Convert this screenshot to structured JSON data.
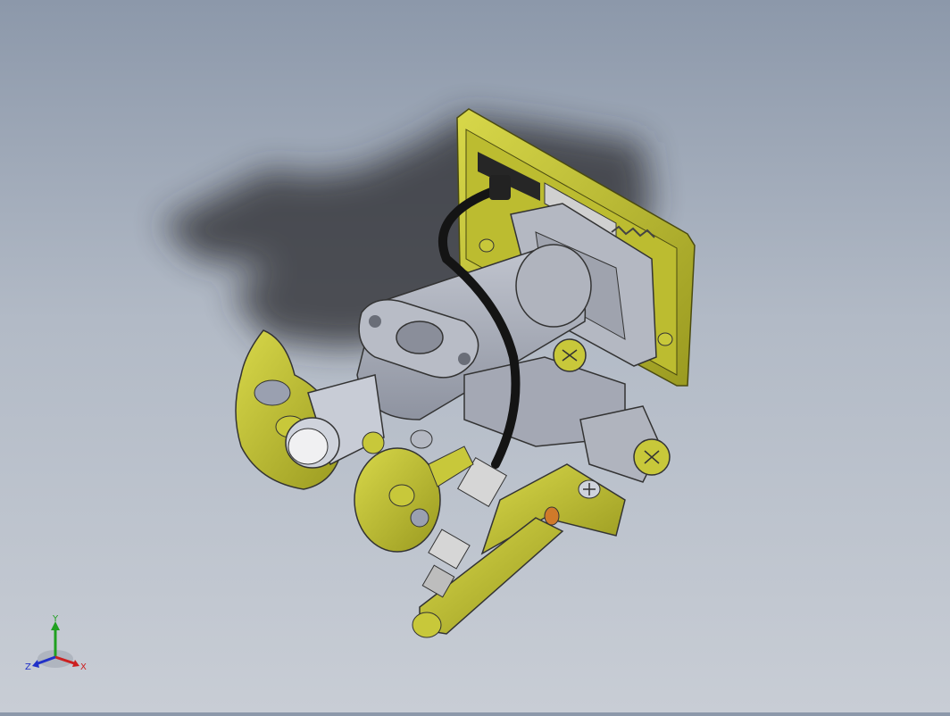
{
  "viewport": {
    "colors": {
      "background_top": "#8c98aa",
      "background_bottom": "#c8cdd5",
      "part_yellow": "#c8c83a",
      "part_gray": "#a8acb8",
      "shadow": "#2a2a2e"
    },
    "model_description_icon": "gas-valve-assembly"
  },
  "triad": {
    "y_label": "Y",
    "x_label": "X",
    "z_label": "Z",
    "colors": {
      "x": "#cc2020",
      "y": "#20a020",
      "z": "#2030c8"
    }
  }
}
